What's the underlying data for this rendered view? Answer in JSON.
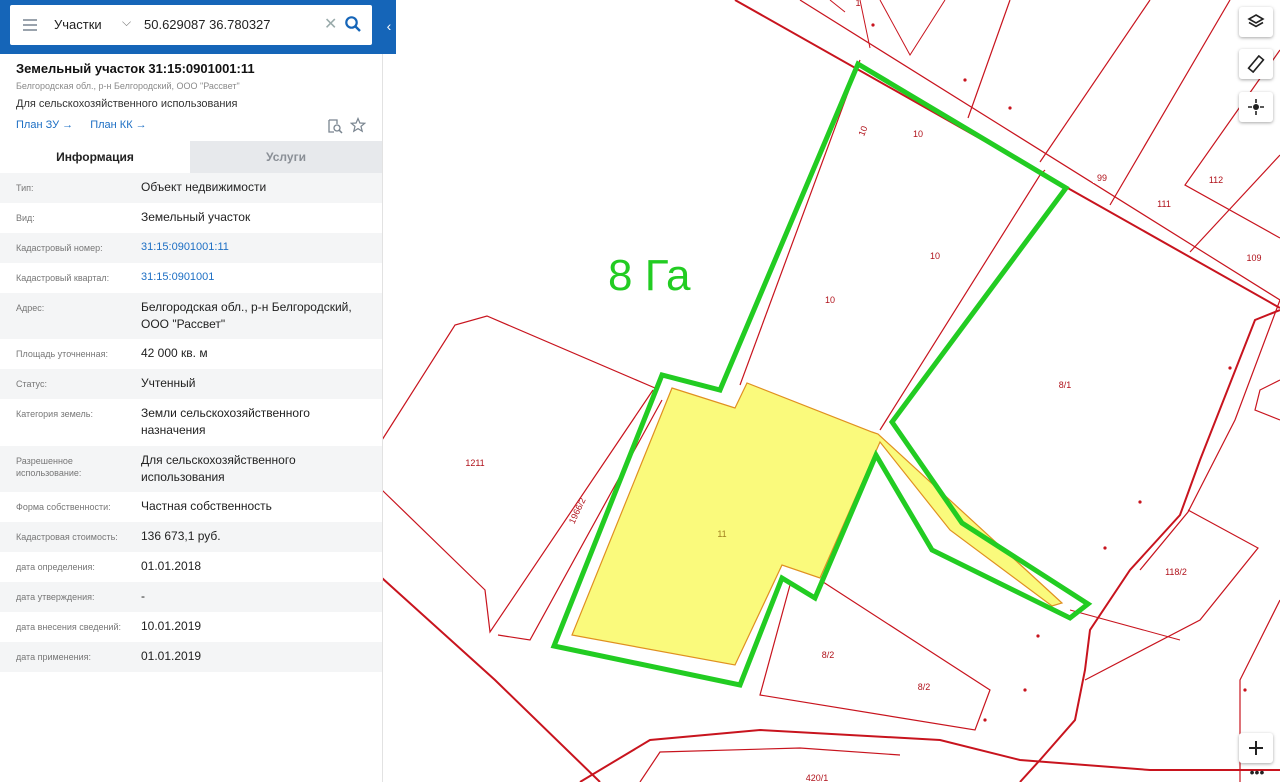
{
  "search": {
    "layer": "Участки",
    "query": "50.629087 36.780327"
  },
  "parcel": {
    "title": "Земельный участок 31:15:0901001:11",
    "address_short": "Белгородская обл., р-н Белгородский, ООО \"Рассвет\"",
    "purpose": "Для сельскохозяйственного использования",
    "plan_zu": "План ЗУ",
    "plan_kk": "План КК"
  },
  "tabs": {
    "info": "Информация",
    "services": "Услуги"
  },
  "rows": [
    {
      "label": "Тип:",
      "value": "Объект недвижимости"
    },
    {
      "label": "Вид:",
      "value": "Земельный участок"
    },
    {
      "label": "Кадастровый номер:",
      "value": "31:15:0901001:11",
      "link": true
    },
    {
      "label": "Кадастровый квартал:",
      "value": "31:15:0901001",
      "link": true
    },
    {
      "label": "Адрес:",
      "value": "Белгородская обл., р-н Белгородский, ООО \"Рассвет\""
    },
    {
      "label": "Площадь уточненная:",
      "value": "42 000 кв. м"
    },
    {
      "label": "Статус:",
      "value": "Учтенный"
    },
    {
      "label": "Категория земель:",
      "value": "Земли сельскохозяйственного назначения"
    },
    {
      "label": "Разрешенное использование:",
      "value": "Для сельскохозяйственного использования"
    },
    {
      "label": "Форма собственности:",
      "value": "Частная собственность"
    },
    {
      "label": "Кадастровая стоимость:",
      "value": "136 673,1 руб."
    },
    {
      "label": "дата определения:",
      "value": "01.01.2018"
    },
    {
      "label": "дата утверждения:",
      "value": "-"
    },
    {
      "label": "дата внесения сведений:",
      "value": "10.01.2019"
    },
    {
      "label": "дата применения:",
      "value": "01.01.2019"
    }
  ],
  "map": {
    "annotation": "8 Га",
    "parcel_labels": [
      "10",
      "10",
      "10",
      "10",
      "99",
      "111",
      "112",
      "109",
      "8/1",
      "1211",
      "1966/2",
      "11",
      "118/2",
      "8/2",
      "8/2",
      "420/1",
      "1"
    ]
  },
  "colors": {
    "topbar": "#1565b8",
    "boundary": "#c8141e",
    "selected_fill": "#fafa7c",
    "highlight": "#22cc22",
    "link": "#1d6fc4"
  },
  "icons": [
    "menu-icon",
    "chevron-down-icon",
    "close-icon",
    "search-icon",
    "chevron-left-icon",
    "document-search-icon",
    "star-icon",
    "layers-icon",
    "ruler-icon",
    "locate-icon",
    "zoom-in-icon",
    "more-icon"
  ]
}
